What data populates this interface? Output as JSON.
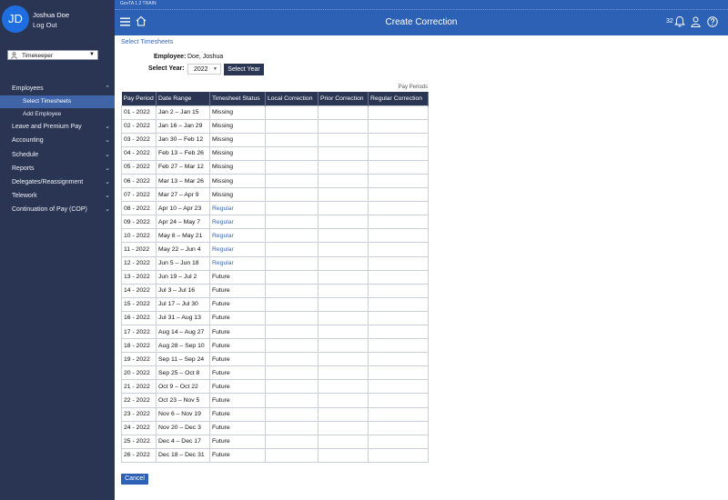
{
  "app": {
    "env_label": "GovTA 1.2 TRAIN",
    "title": "Create Correction",
    "notification_count": "32"
  },
  "user": {
    "initials": "JD",
    "name": "Joshua Doe",
    "logout_label": "Log Out",
    "role": "Timekeeper"
  },
  "nav": {
    "employees": "Employees",
    "select_timesheets": "Select Timesheets",
    "add_employee": "Add Employee",
    "leave": "Leave and Premium Pay",
    "accounting": "Accounting",
    "schedule": "Schedule",
    "reports": "Reports",
    "delegates": "Delegates/Reassignment",
    "telework": "Telework",
    "cop": "Continuation of Pay (COP)"
  },
  "form": {
    "section_title": "Select Timesheets",
    "employee_label": "Employee:",
    "employee_value": "Doe, Joshua",
    "year_label": "Select Year:",
    "year_value": "2022",
    "select_year_button": "Select Year",
    "pay_periods_label": "Pay Periods",
    "cancel_button": "Cancel"
  },
  "table": {
    "headers": [
      "Pay Period",
      "Date Range",
      "Timesheet Status",
      "Local Correction",
      "Prior Correction",
      "Regular Correction"
    ],
    "rows": [
      [
        "01 - 2022",
        "Jan 2 – Jan 15",
        "Missing"
      ],
      [
        "02 - 2022",
        "Jan 16 – Jan 29",
        "Missing"
      ],
      [
        "03 - 2022",
        "Jan 30 – Feb 12",
        "Missing"
      ],
      [
        "04 - 2022",
        "Feb 13 – Feb 26",
        "Missing"
      ],
      [
        "05 - 2022",
        "Feb 27 – Mar 12",
        "Missing"
      ],
      [
        "06 - 2022",
        "Mar 13 – Mar 26",
        "Missing"
      ],
      [
        "07 - 2022",
        "Mar 27 – Apr 9",
        "Missing"
      ],
      [
        "08 - 2022",
        "Apr 10 – Apr 23",
        "Regular"
      ],
      [
        "09 - 2022",
        "Apr 24 – May 7",
        "Regular"
      ],
      [
        "10 - 2022",
        "May 8 – May 21",
        "Regular"
      ],
      [
        "11 - 2022",
        "May 22 – Jun 4",
        "Regular"
      ],
      [
        "12 - 2022",
        "Jun 5 – Jun 18",
        "Regular"
      ],
      [
        "13 - 2022",
        "Jun 19 – Jul 2",
        "Future"
      ],
      [
        "14 - 2022",
        "Jul 3 – Jul 16",
        "Future"
      ],
      [
        "15 - 2022",
        "Jul 17 – Jul 30",
        "Future"
      ],
      [
        "16 - 2022",
        "Jul 31 – Aug 13",
        "Future"
      ],
      [
        "17 - 2022",
        "Aug 14 – Aug 27",
        "Future"
      ],
      [
        "18 - 2022",
        "Aug 28 – Sep 10",
        "Future"
      ],
      [
        "19 - 2022",
        "Sep 11 – Sep 24",
        "Future"
      ],
      [
        "20 - 2022",
        "Sep 25 – Oct 8",
        "Future"
      ],
      [
        "21 - 2022",
        "Oct 9 – Oct 22",
        "Future"
      ],
      [
        "22 - 2022",
        "Oct 23 – Nov 5",
        "Future"
      ],
      [
        "23 - 2022",
        "Nov 6 – Nov 19",
        "Future"
      ],
      [
        "24 - 2022",
        "Nov 20 – Dec 3",
        "Future"
      ],
      [
        "25 - 2022",
        "Dec 4 – Dec 17",
        "Future"
      ],
      [
        "26 - 2022",
        "Dec 18 – Dec 31",
        "Future"
      ]
    ]
  },
  "colors": {
    "sidebar_bg": "#2a3553",
    "topbar_bg": "#2c61b6",
    "link": "#3c67b1",
    "active_nav": "#3f64a8"
  }
}
